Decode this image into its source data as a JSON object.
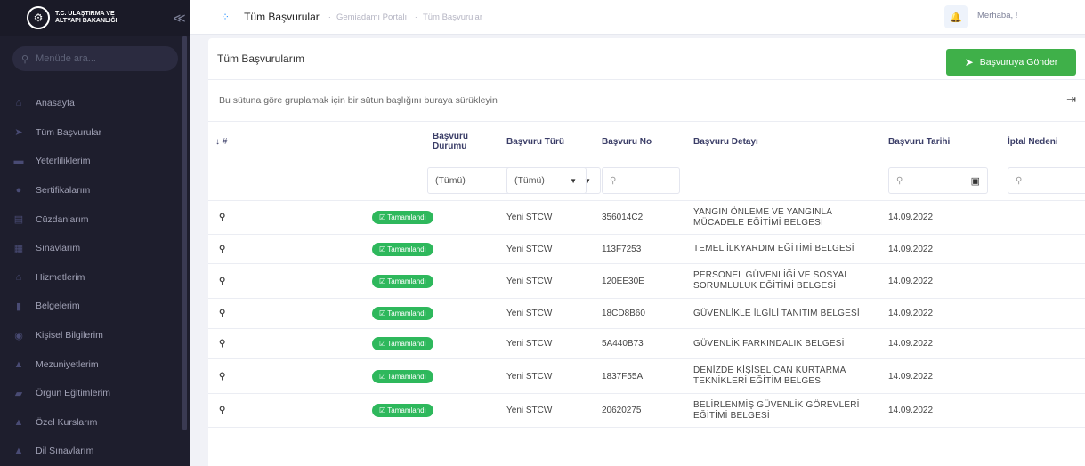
{
  "sidebar": {
    "brand_line1": "T.C. ULAŞTIRMA VE",
    "brand_line2": "ALTYAPI BAKANLIĞI",
    "search_placeholder": "Menüde ara...",
    "items": [
      {
        "label": "Anasayfa",
        "icon": "home-icon"
      },
      {
        "label": "Tüm Başvurular",
        "icon": "paper-plane-icon"
      },
      {
        "label": "Yeterliliklerim",
        "icon": "box-icon"
      },
      {
        "label": "Sertifikalarım",
        "icon": "circle-icon"
      },
      {
        "label": "Cüzdanlarım",
        "icon": "wallet-icon"
      },
      {
        "label": "Sınavlarım",
        "icon": "document-icon"
      },
      {
        "label": "Hizmetlerim",
        "icon": "bank-icon"
      },
      {
        "label": "Belgelerim",
        "icon": "file-icon"
      },
      {
        "label": "Kişisel Bilgilerim",
        "icon": "user-icon"
      },
      {
        "label": "Mezuniyetlerim",
        "icon": "graduation-cap-icon"
      },
      {
        "label": "Örgün Eğitimlerim",
        "icon": "book-icon"
      },
      {
        "label": "Özel Kurslarım",
        "icon": "graduation-cap-icon"
      },
      {
        "label": "Dil Sınavlarım",
        "icon": "graduation-cap-icon"
      }
    ]
  },
  "topbar": {
    "title": "Tüm Başvurular",
    "breadcrumb": [
      "Gemiadamı Portalı",
      "Tüm Başvurular"
    ],
    "greeting": "Merhaba, !"
  },
  "card": {
    "title": "Tüm Başvurularım",
    "send_button": "Başvuruya Gönder",
    "group_hint": "Bu sütuna göre gruplamak için bir sütun başlığını buraya sürükleyin"
  },
  "table": {
    "columns": [
      "↓ #",
      "Başvuru Durumu",
      "Başvuru Türü",
      "Başvuru No",
      "Başvuru Detayı",
      "Başvuru Tarihi",
      "İptal Nedeni"
    ],
    "filters": {
      "durum": "(Tümü)",
      "tur": "(Tümü)"
    },
    "rows": [
      {
        "durum": "Tamamlandı",
        "tur": "Yeni STCW",
        "no": "356014C2",
        "detay": "YANGIN ÖNLEME VE YANGINLA MÜCADELE EĞİTİMİ BELGESİ",
        "tarih": "14.09.2022"
      },
      {
        "durum": "Tamamlandı",
        "tur": "Yeni STCW",
        "no": "113F7253",
        "detay": "TEMEL İLKYARDIM EĞİTİMİ BELGESİ",
        "tarih": "14.09.2022"
      },
      {
        "durum": "Tamamlandı",
        "tur": "Yeni STCW",
        "no": "120EE30E",
        "detay": "PERSONEL GÜVENLİĞİ VE SOSYAL SORUMLULUK EĞİTİMİ BELGESİ",
        "tarih": "14.09.2022"
      },
      {
        "durum": "Tamamlandı",
        "tur": "Yeni STCW",
        "no": "18CD8B60",
        "detay": "GÜVENLİKLE İLGİLİ TANITIM BELGESİ",
        "tarih": "14.09.2022"
      },
      {
        "durum": "Tamamlandı",
        "tur": "Yeni STCW",
        "no": "5A440B73",
        "detay": "GÜVENLİK FARKINDALIK BELGESİ",
        "tarih": "14.09.2022"
      },
      {
        "durum": "Tamamlandı",
        "tur": "Yeni STCW",
        "no": "1837F55A",
        "detay": "DENİZDE KİŞİSEL CAN KURTARMA TEKNİKLERİ EĞİTİM BELGESİ",
        "tarih": "14.09.2022"
      },
      {
        "durum": "Tamamlandı",
        "tur": "Yeni STCW",
        "no": "20620275",
        "detay": "BELİRLENMİŞ GÜVENLİK GÖREVLERİ EĞİTİMİ BELGESİ",
        "tarih": "14.09.2022"
      }
    ]
  },
  "colors": {
    "sidebar_bg": "#1e1e2d",
    "accent": "#3699ff",
    "success": "#3fb049"
  }
}
